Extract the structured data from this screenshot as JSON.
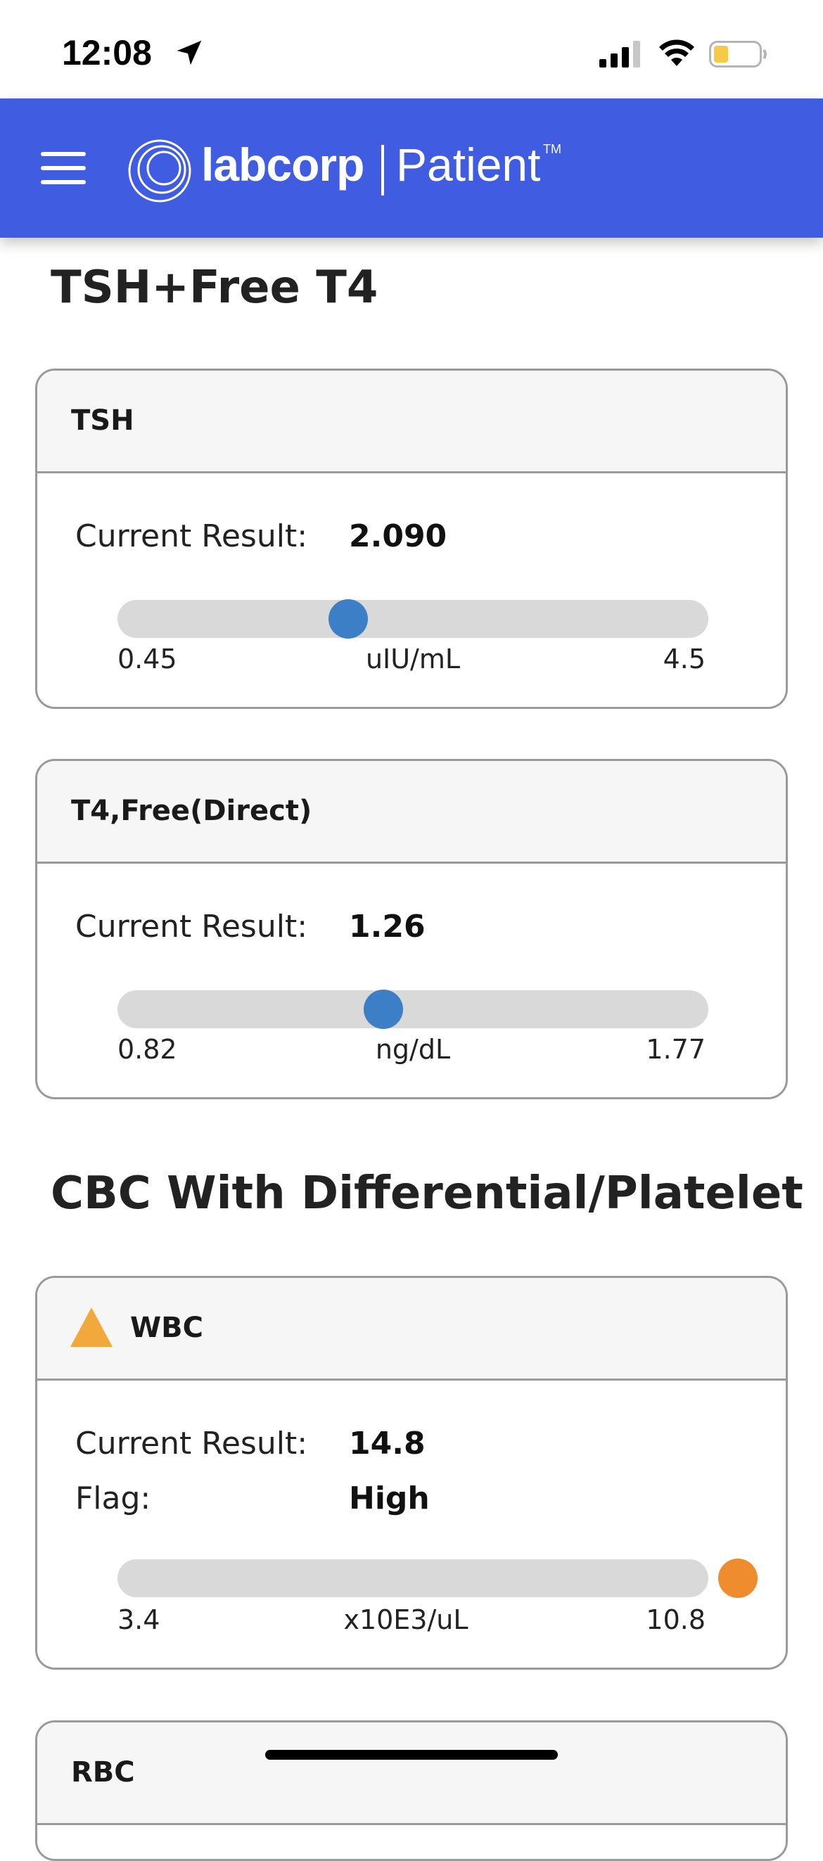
{
  "status_bar": {
    "time": "12:08",
    "icons": [
      "location-arrow-icon",
      "cellular-signal-icon",
      "wifi-icon",
      "battery-low-icon"
    ],
    "battery_color": "#f7c948"
  },
  "header": {
    "brand": "labcorp",
    "product": "Patient",
    "trademark": "TM",
    "background": "#405ce0"
  },
  "sections": [
    {
      "title": "TSH+Free T4",
      "results": [
        {
          "name": "TSH",
          "result_label": "Current Result:",
          "result_value": "2.090",
          "range_low": "0.45",
          "range_high": "4.5",
          "unit": "uIU/mL",
          "marker_position": 0.39,
          "marker_color": "#3d7fc7",
          "flagged": false
        },
        {
          "name": "T4,Free(Direct)",
          "result_label": "Current Result:",
          "result_value": "1.26",
          "range_low": "0.82",
          "range_high": "1.77",
          "unit": "ng/dL",
          "marker_position": 0.45,
          "marker_color": "#3d7fc7",
          "flagged": false
        }
      ]
    },
    {
      "title": "CBC With Differential/Platelet",
      "results": [
        {
          "name": "WBC",
          "result_label": "Current Result:",
          "result_value": "14.8",
          "flag_label": "Flag:",
          "flag_value": "High",
          "range_low": "3.4",
          "range_high": "10.8",
          "unit": "x10E3/uL",
          "marker_position": 1.05,
          "marker_color": "#ef8c2e",
          "flagged": true,
          "warning_color": "#f2a93b"
        },
        {
          "name": "RBC"
        }
      ]
    }
  ]
}
